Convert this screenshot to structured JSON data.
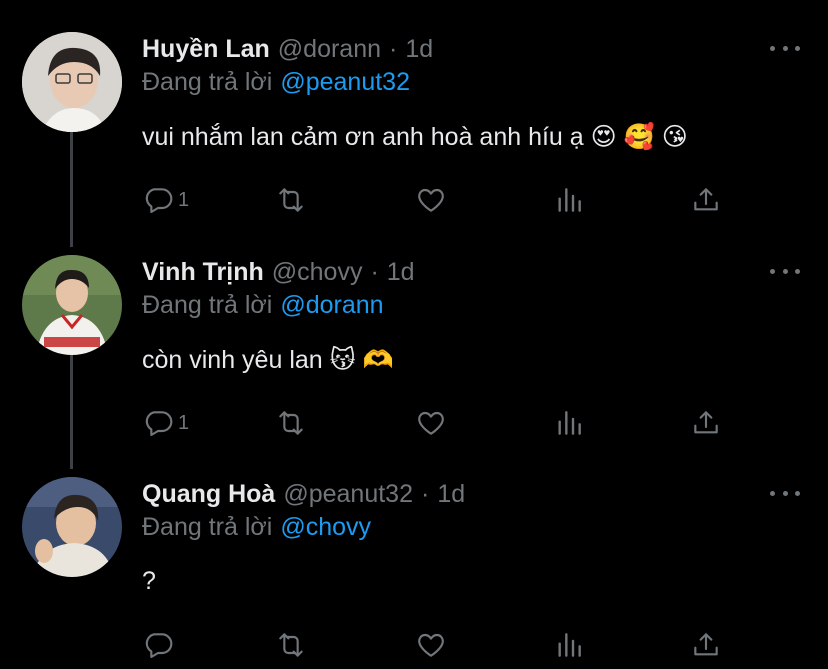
{
  "tweets": [
    {
      "name": "Huyền Lan",
      "handle": "@dorann",
      "separator": "·",
      "time": "1d",
      "reply_prefix": "Đang trả lời",
      "reply_to": "@peanut32",
      "text": "vui nhắm lan cảm ơn anh hoà anh híu ạ 😍 🥰 😘",
      "reply_count": "1",
      "avatar": "avatar-huyen-lan"
    },
    {
      "name": "Vinh Trịnh",
      "handle": "@chovy",
      "separator": "·",
      "time": "1d",
      "reply_prefix": "Đang trả lời",
      "reply_to": "@dorann",
      "text": "còn vinh yêu lan 😽 🫶",
      "reply_count": "1",
      "avatar": "avatar-vinh-trinh"
    },
    {
      "name": "Quang Hoà",
      "handle": "@peanut32",
      "separator": "·",
      "time": "1d",
      "reply_prefix": "Đang trả lời",
      "reply_to": "@chovy",
      "text": "?",
      "reply_count": "",
      "avatar": "avatar-quang-hoa"
    }
  ],
  "icons": [
    "reply-icon",
    "retweet-icon",
    "like-icon",
    "stats-icon",
    "share-icon",
    "more-icon"
  ],
  "colors": {
    "background": "#000000",
    "text": "#e7e9ea",
    "muted": "#71767b",
    "link": "#1d9bf0",
    "thread_line": "#3d4146"
  }
}
